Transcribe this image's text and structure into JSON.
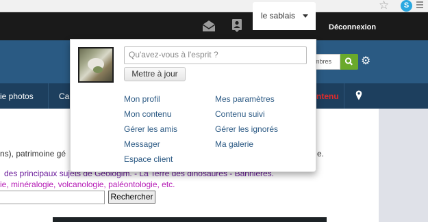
{
  "chrome": {
    "star_glyph": "☆",
    "skype_glyph": "S"
  },
  "topbar": {
    "username": "le sablais",
    "logout_label": "Déconnexion",
    "icons": [
      "mail-icon",
      "contact-card-icon",
      "caret-down-icon"
    ]
  },
  "header": {
    "search_partial_text": "mbres",
    "icons": [
      "search-icon",
      "gear-icon"
    ]
  },
  "nav": {
    "items": [
      "ie photos",
      "Ca",
      "ntenu"
    ],
    "icons": [
      "map-pin-icon"
    ]
  },
  "content": {
    "line1_left": "ns), patrimoine gé",
    "line1_right": "e.",
    "line2": "des principaux sujets de Géologim. - La Terre des dinosaures - Bannières.",
    "line3": "ie, minéralogie, volcanologie, paléontologie, etc.",
    "search_button": "Rechercher"
  },
  "dropdown": {
    "status_placeholder": "Qu'avez-vous à l'esprit ?",
    "update_button": "Mettre à jour",
    "links_left": [
      "Mon profil",
      "Mon contenu",
      "Gérer les amis",
      "Messager",
      "Espace client"
    ],
    "links_right": [
      "Mes paramètres",
      "Contenu suivi",
      "Gérer les ignorés",
      "Ma galerie"
    ]
  },
  "colors": {
    "topbar": "#1a1a1a",
    "header_blue": "#2a5a83",
    "nav_blue": "#1d3f5e",
    "link_blue": "#2c5a84",
    "search_green": "#6aa92b",
    "nav_red": "#e02b2b"
  }
}
